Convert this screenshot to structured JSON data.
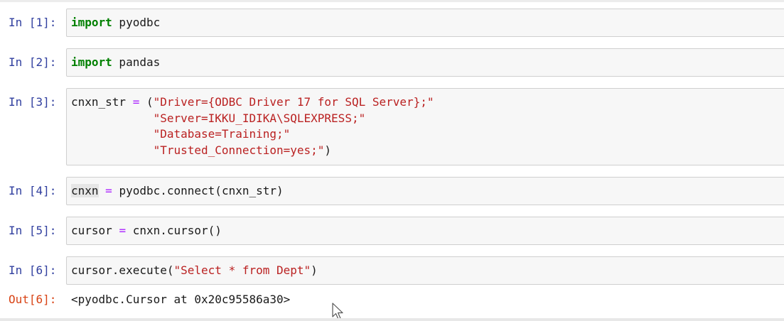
{
  "cells": [
    {
      "prompt": "In [1]:",
      "code": [
        [
          {
            "t": "import",
            "c": "kw"
          },
          {
            "t": " pyodbc",
            "c": ""
          }
        ]
      ]
    },
    {
      "prompt": "In [2]:",
      "code": [
        [
          {
            "t": "import",
            "c": "kw"
          },
          {
            "t": " pandas",
            "c": ""
          }
        ]
      ]
    },
    {
      "prompt": "In [3]:",
      "code": [
        [
          {
            "t": "cnxn_str ",
            "c": ""
          },
          {
            "t": "=",
            "c": "op"
          },
          {
            "t": " (",
            "c": ""
          },
          {
            "t": "\"Driver={ODBC Driver 17 for SQL Server};\"",
            "c": "str"
          }
        ],
        [
          {
            "t": "            ",
            "c": ""
          },
          {
            "t": "\"Server=IKKU_IDIKA\\SQLEXPRESS;\"",
            "c": "str"
          }
        ],
        [
          {
            "t": "            ",
            "c": ""
          },
          {
            "t": "\"Database=Training;\"",
            "c": "str"
          }
        ],
        [
          {
            "t": "            ",
            "c": ""
          },
          {
            "t": "\"Trusted_Connection=yes;\"",
            "c": "str"
          },
          {
            "t": ")",
            "c": ""
          }
        ]
      ]
    },
    {
      "prompt": "In [4]:",
      "code": [
        [
          {
            "t": "cnxn",
            "c": "hl"
          },
          {
            "t": " ",
            "c": ""
          },
          {
            "t": "=",
            "c": "op"
          },
          {
            "t": " pyodbc.connect(cnxn_str)",
            "c": ""
          }
        ]
      ]
    },
    {
      "prompt": "In [5]:",
      "code": [
        [
          {
            "t": "cursor ",
            "c": ""
          },
          {
            "t": "=",
            "c": "op"
          },
          {
            "t": " cnxn.cursor()",
            "c": ""
          }
        ]
      ]
    },
    {
      "prompt": "In [6]:",
      "code": [
        [
          {
            "t": "cursor.execute(",
            "c": ""
          },
          {
            "t": "\"Select * from Dept\"",
            "c": "str"
          },
          {
            "t": ")",
            "c": ""
          }
        ]
      ]
    }
  ],
  "output": {
    "prompt": "Out[6]:",
    "text": "<pyodbc.Cursor at 0x20c95586a30>"
  }
}
